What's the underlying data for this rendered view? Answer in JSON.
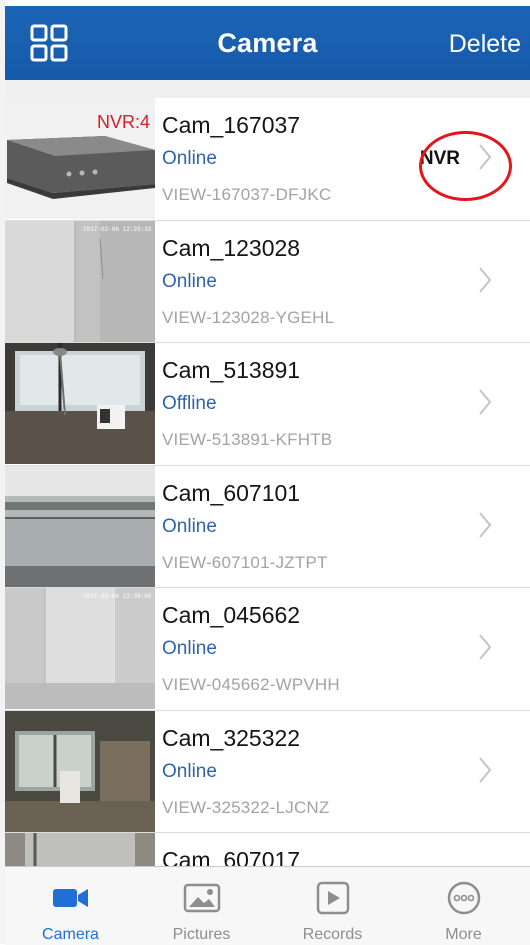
{
  "navbar": {
    "title": "Camera",
    "delete_label": "Delete"
  },
  "cameras": [
    {
      "name": "Cam_167037",
      "status": "Online",
      "id": "VIEW-167037-DFJKC",
      "tag": "NVR:4",
      "type_label": "NVR",
      "thumb": "nvr-device"
    },
    {
      "name": "Cam_123028",
      "status": "Online",
      "id": "VIEW-123028-YGEHL",
      "thumb": "white-wall-corner"
    },
    {
      "name": "Cam_513891",
      "status": "Offline",
      "id": "VIEW-513891-KFHTB",
      "thumb": "office-window-lamp"
    },
    {
      "name": "Cam_607101",
      "status": "Online",
      "id": "VIEW-607101-JZTPT",
      "thumb": "window-view"
    },
    {
      "name": "Cam_045662",
      "status": "Online",
      "id": "VIEW-045662-WPVHH",
      "thumb": "white-room"
    },
    {
      "name": "Cam_325322",
      "status": "Online",
      "id": "VIEW-325322-LJCNZ",
      "thumb": "office-interior"
    },
    {
      "name": "Cam_607017",
      "status": "",
      "id": "",
      "thumb": "partial-room"
    }
  ],
  "tabs": [
    {
      "label": "Camera",
      "icon": "video-camera-icon",
      "active": true
    },
    {
      "label": "Pictures",
      "icon": "picture-icon",
      "active": false
    },
    {
      "label": "Records",
      "icon": "play-record-icon",
      "active": false
    },
    {
      "label": "More",
      "icon": "more-dots-icon",
      "active": false
    }
  ],
  "colors": {
    "nav": "#1a5fb0",
    "active_tab": "#1f6fd4",
    "status_text": "#2f64aa",
    "highlight_circle": "#e3171b",
    "nvr_tag": "#d4202a"
  }
}
